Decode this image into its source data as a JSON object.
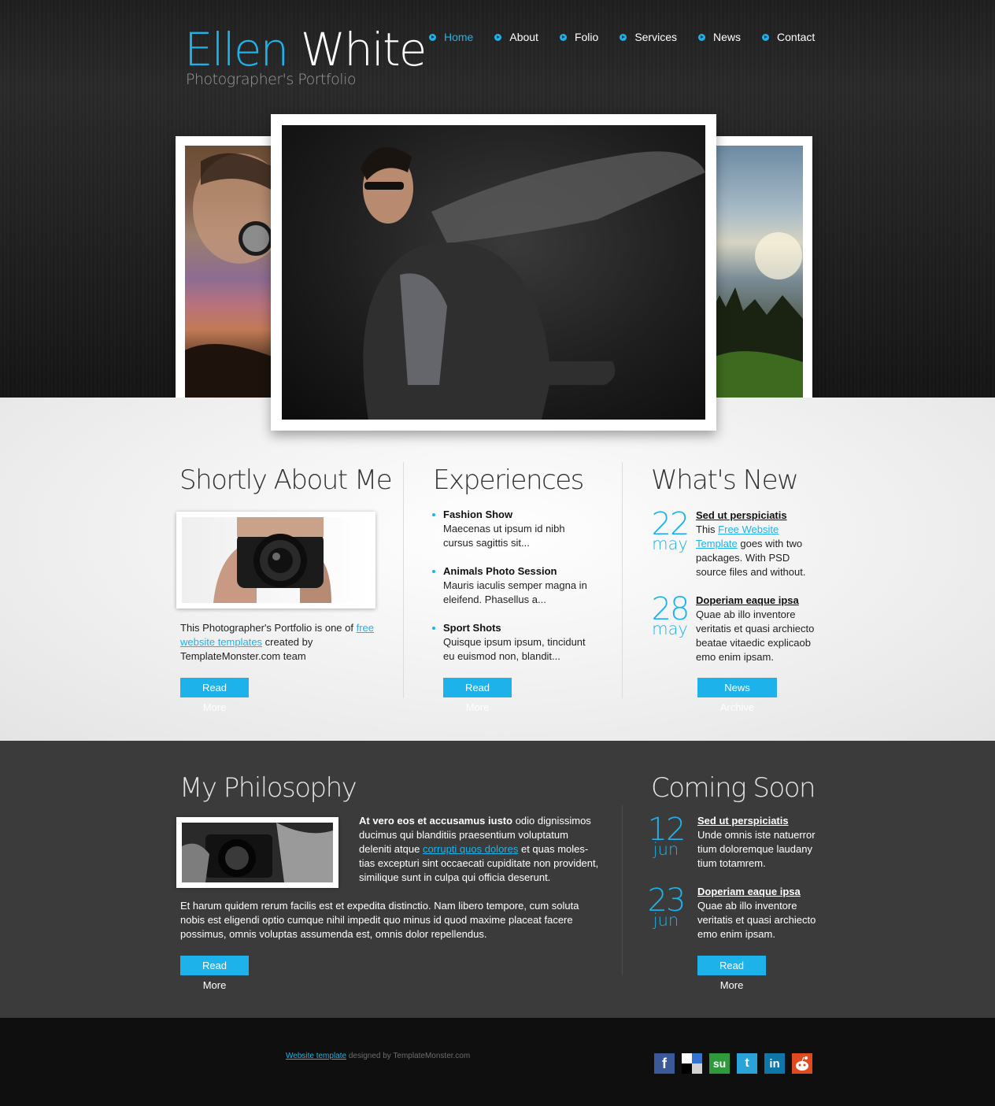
{
  "brand": {
    "first": "Ellen",
    "last": "White",
    "tagline": "Photographer's Portfolio"
  },
  "nav": [
    {
      "label": "Home",
      "active": true
    },
    {
      "label": "About",
      "active": false
    },
    {
      "label": "Folio",
      "active": false
    },
    {
      "label": "Services",
      "active": false
    },
    {
      "label": "News",
      "active": false
    },
    {
      "label": "Contact",
      "active": false
    }
  ],
  "about": {
    "heading": "Shortly About Me",
    "text_before": "This Photographer's Portfolio is one of ",
    "link": "free website templates",
    "text_after": " created by TemplateMonster.com team",
    "button": "Read More"
  },
  "experiences": {
    "heading": "Experiences",
    "items": [
      {
        "title": "Fashion Show",
        "desc": "Maecenas ut ipsum id nibh cursus sagittis sit..."
      },
      {
        "title": "Animals Photo Session",
        "desc": "Mauris iaculis semper magna in eleifend. Phasellus a..."
      },
      {
        "title": "Sport Shots",
        "desc": "Quisque ipsum ipsum, tincidunt eu euismod non, blandit..."
      }
    ],
    "button": "Read More"
  },
  "whats_new": {
    "heading": "What's New",
    "items": [
      {
        "day": "22",
        "month": "may",
        "title": "Sed ut perspiciatis",
        "text_before": "This ",
        "link": "Free Website Template",
        "text_after": " goes with two packages. With PSD source files and without."
      },
      {
        "day": "28",
        "month": "may",
        "title": "Doperiam eaque ipsa",
        "text": "Quae ab illo inventore veritatis et quasi archiecto beatae vitaedic explicaob emo enim ipsam."
      }
    ],
    "button": "News Archive"
  },
  "philosophy": {
    "heading": "My Philosophy",
    "lead_bold": "At vero eos et accusamus iusto",
    "lead_text": " odio dignissimos ducimus qui blanditiis praesentium voluptatum deleniti atque ",
    "lead_link": "corrupti quos dolores",
    "lead_after": " et quas moles-tias excepturi sint occaecati cupiditate non provident, similique sunt in culpa qui officia deserunt.",
    "paragraph": "Et harum quidem rerum facilis est et expedita distinctio. Nam libero tempore, cum soluta nobis est eligendi optio cumque nihil impedit quo minus id quod maxime placeat facere possimus, omnis voluptas assumenda est, omnis dolor repellendus.",
    "button": "Read More"
  },
  "coming_soon": {
    "heading": "Coming Soon",
    "items": [
      {
        "day": "12",
        "month": "jun",
        "title": "Sed ut perspiciatis",
        "text": "Unde omnis iste natuerror tium doloremque laudany tium totamrem."
      },
      {
        "day": "23",
        "month": "jun",
        "title": "Doperiam eaque ipsa",
        "text": "Quae ab illo inventore veritatis et quasi archiecto emo enim ipsam."
      }
    ],
    "button": "Read More"
  },
  "footer": {
    "link": "Website template",
    "text": " designed by TemplateMonster.com",
    "social": [
      {
        "name": "facebook-icon",
        "glyph": "f",
        "color": "#3b5998"
      },
      {
        "name": "delicious-icon",
        "glyph": "",
        "color": "#ffffff"
      },
      {
        "name": "stumbleupon-icon",
        "glyph": "su",
        "color": "#2e9a3c"
      },
      {
        "name": "twitter-icon",
        "glyph": "t",
        "color": "#2aa3d9"
      },
      {
        "name": "linkedin-icon",
        "glyph": "in",
        "color": "#0e76a8"
      },
      {
        "name": "reddit-icon",
        "glyph": "",
        "color": "#e04a21"
      }
    ]
  },
  "colors": {
    "accent": "#1db3ea",
    "header_bg": "#222222",
    "band_bg": "#3b3b3b",
    "footer_bg": "#0f0f0f"
  }
}
